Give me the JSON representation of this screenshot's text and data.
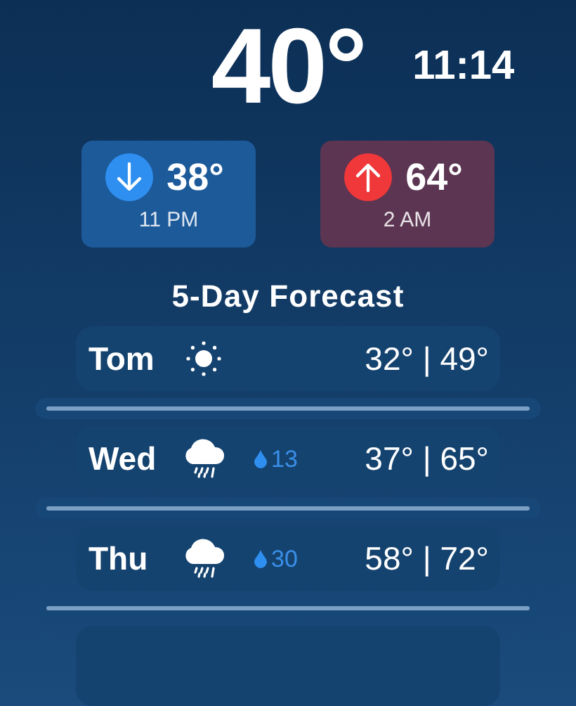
{
  "current": {
    "temperature": "40°",
    "time": "11:14"
  },
  "extremes": [
    {
      "kind": "low",
      "temperature": "38°",
      "time": "11 PM"
    },
    {
      "kind": "high",
      "temperature": "64°",
      "time": "2 AM"
    }
  ],
  "forecast": {
    "title": "5-Day Forecast",
    "days": [
      {
        "day": "Tom",
        "kind": "sun",
        "temps": "32° | 49°"
      },
      {
        "day": "Wed",
        "kind": "rain",
        "precipitation": "13",
        "temps": "37° | 65°"
      },
      {
        "day": "Thu",
        "kind": "rain",
        "precipitation": "30",
        "temps": "58° | 72°"
      }
    ]
  }
}
